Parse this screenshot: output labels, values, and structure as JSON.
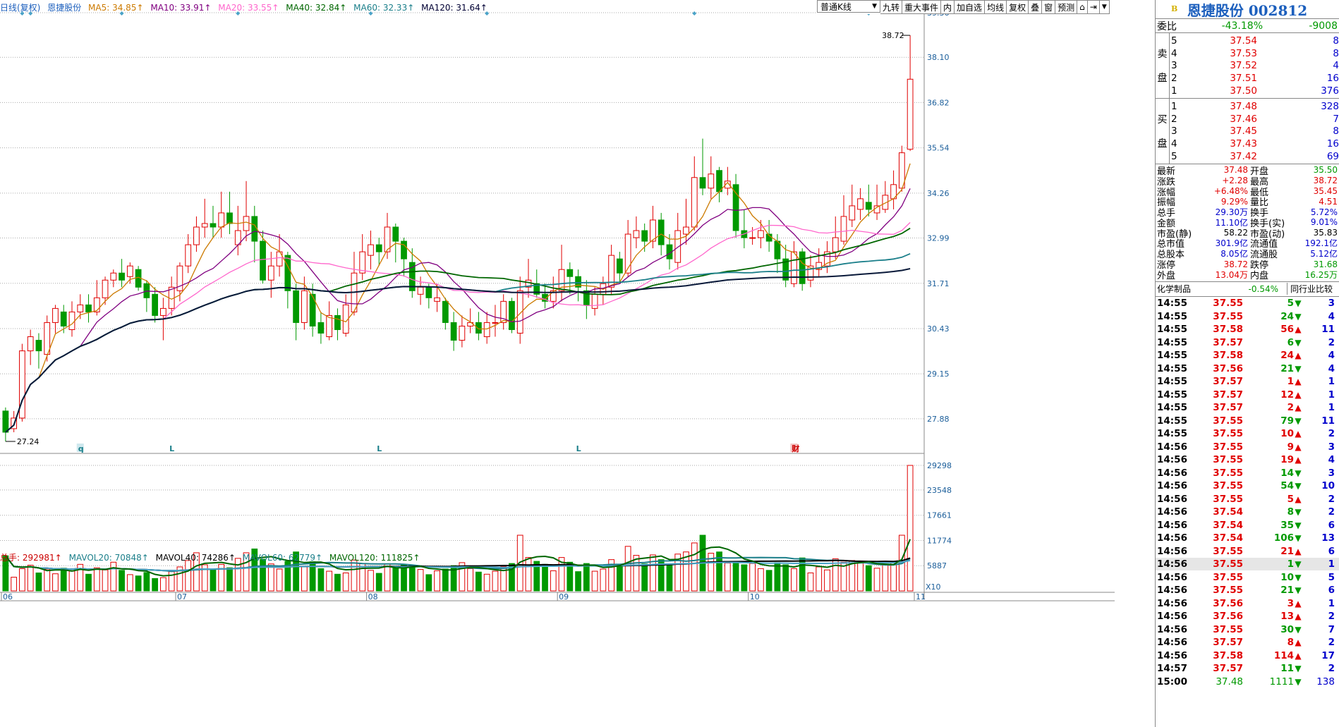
{
  "header": {
    "kline_label": "日线(复权)",
    "stock_name": "恩捷股份",
    "ma": [
      {
        "label": "MA5: 34.85↑",
        "color": "#cc7a00"
      },
      {
        "label": "MA10: 33.91↑",
        "color": "#800080"
      },
      {
        "label": "MA20: 33.55↑",
        "color": "#ff66cc"
      },
      {
        "label": "MA40: 32.84↑",
        "color": "#006600"
      },
      {
        "label": "MA60: 32.33↑",
        "color": "#1b7f8a"
      },
      {
        "label": "MA120: 31.64↑",
        "color": "#000033"
      }
    ]
  },
  "toolbar": {
    "select_value": "普通K线",
    "buttons": [
      "九转",
      "重大事件",
      "内",
      "加自选",
      "均线",
      "复权",
      "叠",
      "窗",
      "预测",
      "⌂",
      "⇥"
    ]
  },
  "price_axis": [
    "39.36",
    "38.10",
    "36.82",
    "35.54",
    "34.26",
    "32.99",
    "31.71",
    "30.43",
    "29.15",
    "27.88"
  ],
  "price_high_label": "38.72",
  "price_low_label": "27.24",
  "markers": [
    {
      "label": "q",
      "color": "#1b7f8a"
    },
    {
      "label": "L",
      "color": "#1b7f8a"
    },
    {
      "label": "L",
      "color": "#1b7f8a"
    },
    {
      "label": "L",
      "color": "#1b7f8a"
    },
    {
      "label": "财",
      "color": "#cc0000"
    }
  ],
  "vol_header": [
    {
      "label": "总手: 292981↑",
      "color": "#cc0000"
    },
    {
      "label": "MAVOL20: 70848↑",
      "color": "#1b7f8a"
    },
    {
      "label": "MAVOL40: 74286↑",
      "color": "#000000"
    },
    {
      "label": "MAVOL60: 62779↑",
      "color": "#1b7f8a"
    },
    {
      "label": "MAVOL120: 111825↑",
      "color": "#006600"
    }
  ],
  "vol_axis": [
    "29298",
    "23548",
    "17661",
    "11774",
    "5887"
  ],
  "vol_unit": "X10",
  "date_axis": [
    "06",
    "07",
    "08",
    "09",
    "10",
    "11"
  ],
  "colors": {
    "up": "#e00000",
    "down": "#009900"
  },
  "panel": {
    "title": "恩捷股份 002812",
    "flag": "B",
    "weibi": {
      "label": "委比",
      "value": "-43.18%",
      "diff": "-9008"
    },
    "sell_label": [
      "卖",
      "盘"
    ],
    "buy_label": [
      "买",
      "盘"
    ],
    "sell": [
      {
        "n": "5",
        "price": "37.54",
        "vol": "8"
      },
      {
        "n": "4",
        "price": "37.53",
        "vol": "8"
      },
      {
        "n": "3",
        "price": "37.52",
        "vol": "4"
      },
      {
        "n": "2",
        "price": "37.51",
        "vol": "16"
      },
      {
        "n": "1",
        "price": "37.50",
        "vol": "376"
      }
    ],
    "buy": [
      {
        "n": "1",
        "price": "37.48",
        "vol": "328"
      },
      {
        "n": "2",
        "price": "37.46",
        "vol": "7"
      },
      {
        "n": "3",
        "price": "37.45",
        "vol": "8"
      },
      {
        "n": "4",
        "price": "37.43",
        "vol": "16"
      },
      {
        "n": "5",
        "price": "37.42",
        "vol": "69"
      }
    ],
    "stats": [
      {
        "l1": "最新",
        "v1": "37.48",
        "c1": "red",
        "l2": "开盘",
        "v2": "35.50",
        "c2": "green"
      },
      {
        "l1": "涨跌",
        "v1": "+2.28",
        "c1": "red",
        "l2": "最高",
        "v2": "38.72",
        "c2": "red"
      },
      {
        "l1": "涨幅",
        "v1": "+6.48%",
        "c1": "red",
        "l2": "最低",
        "v2": "35.45",
        "c2": "red"
      },
      {
        "l1": "振幅",
        "v1": "9.29%",
        "c1": "red",
        "l2": "量比",
        "v2": "4.51",
        "c2": "red"
      },
      {
        "l1": "总手",
        "v1": "29.30万",
        "c1": "blue",
        "l2": "换手",
        "v2": "5.72%",
        "c2": "blue"
      },
      {
        "l1": "金额",
        "v1": "11.10亿",
        "c1": "blue",
        "l2": "换手(实)",
        "v2": "9.01%",
        "c2": "blue"
      },
      {
        "l1": "市盈(静)",
        "v1": "58.22",
        "c1": "",
        "l2": "市盈(动)",
        "v2": "35.83",
        "c2": ""
      },
      {
        "l1": "总市值",
        "v1": "301.9亿",
        "c1": "blue",
        "l2": "流通值",
        "v2": "192.1亿",
        "c2": "blue"
      },
      {
        "l1": "总股本",
        "v1": "8.05亿",
        "c1": "blue",
        "l2": "流通股",
        "v2": "5.12亿",
        "c2": "blue"
      },
      {
        "l1": "涨停",
        "v1": "38.72",
        "c1": "red",
        "l2": "跌停",
        "v2": "31.68",
        "c2": "green"
      },
      {
        "l1": "外盘",
        "v1": "13.04万",
        "c1": "red",
        "l2": "内盘",
        "v2": "16.25万",
        "c2": "green"
      }
    ],
    "industry": {
      "name": "化学制品",
      "change": "-0.54%",
      "button": "同行业比较"
    },
    "ticks": [
      {
        "t": "14:55",
        "p": "37.55",
        "v": "5",
        "d": "down",
        "n": "3"
      },
      {
        "t": "14:55",
        "p": "37.55",
        "v": "24",
        "d": "down",
        "n": "4"
      },
      {
        "t": "14:55",
        "p": "37.58",
        "v": "56",
        "d": "up",
        "n": "11"
      },
      {
        "t": "14:55",
        "p": "37.57",
        "v": "6",
        "d": "down",
        "n": "2"
      },
      {
        "t": "14:55",
        "p": "37.58",
        "v": "24",
        "d": "up",
        "n": "4"
      },
      {
        "t": "14:55",
        "p": "37.56",
        "v": "21",
        "d": "down",
        "n": "4"
      },
      {
        "t": "14:55",
        "p": "37.57",
        "v": "1",
        "d": "up",
        "n": "1"
      },
      {
        "t": "14:55",
        "p": "37.57",
        "v": "12",
        "d": "up",
        "n": "1"
      },
      {
        "t": "14:55",
        "p": "37.57",
        "v": "2",
        "d": "up",
        "n": "1"
      },
      {
        "t": "14:55",
        "p": "37.55",
        "v": "79",
        "d": "down",
        "n": "11"
      },
      {
        "t": "14:55",
        "p": "37.55",
        "v": "10",
        "d": "up",
        "n": "2"
      },
      {
        "t": "14:56",
        "p": "37.55",
        "v": "9",
        "d": "up",
        "n": "3"
      },
      {
        "t": "14:56",
        "p": "37.55",
        "v": "19",
        "d": "up",
        "n": "4"
      },
      {
        "t": "14:56",
        "p": "37.55",
        "v": "14",
        "d": "down",
        "n": "3"
      },
      {
        "t": "14:56",
        "p": "37.55",
        "v": "54",
        "d": "down",
        "n": "10"
      },
      {
        "t": "14:56",
        "p": "37.55",
        "v": "5",
        "d": "up",
        "n": "2"
      },
      {
        "t": "14:56",
        "p": "37.54",
        "v": "8",
        "d": "down",
        "n": "2"
      },
      {
        "t": "14:56",
        "p": "37.54",
        "v": "35",
        "d": "down",
        "n": "6"
      },
      {
        "t": "14:56",
        "p": "37.54",
        "v": "106",
        "d": "down",
        "n": "13"
      },
      {
        "t": "14:56",
        "p": "37.55",
        "v": "21",
        "d": "up",
        "n": "6"
      },
      {
        "t": "14:56",
        "p": "37.55",
        "v": "1",
        "d": "down",
        "n": "1"
      },
      {
        "t": "14:56",
        "p": "37.55",
        "v": "10",
        "d": "down",
        "n": "5"
      },
      {
        "t": "14:56",
        "p": "37.55",
        "v": "21",
        "d": "down",
        "n": "6"
      },
      {
        "t": "14:56",
        "p": "37.56",
        "v": "3",
        "d": "up",
        "n": "1"
      },
      {
        "t": "14:56",
        "p": "37.56",
        "v": "13",
        "d": "up",
        "n": "2"
      },
      {
        "t": "14:56",
        "p": "37.55",
        "v": "30",
        "d": "down",
        "n": "7"
      },
      {
        "t": "14:56",
        "p": "37.57",
        "v": "8",
        "d": "up",
        "n": "2"
      },
      {
        "t": "14:56",
        "p": "37.58",
        "v": "114",
        "d": "up",
        "n": "17"
      },
      {
        "t": "14:57",
        "p": "37.57",
        "v": "11",
        "d": "down",
        "n": "2"
      },
      {
        "t": "15:00",
        "p": "37.48",
        "v": "1111",
        "d": "down",
        "n": "138"
      }
    ]
  },
  "chart_data": {
    "type": "candlestick",
    "y_range_price": [
      27.24,
      39.36
    ],
    "y_range_volume": [
      0,
      29298
    ],
    "candles": [
      [
        28.1,
        27.5,
        28.2,
        27.24,
        8200
      ],
      [
        27.6,
        27.9,
        28.1,
        27.5,
        3200
      ],
      [
        27.9,
        29.8,
        30.0,
        27.8,
        5200
      ],
      [
        29.8,
        30.2,
        30.4,
        29.4,
        6000
      ],
      [
        30.1,
        29.8,
        30.3,
        29.3,
        4200
      ],
      [
        29.7,
        30.6,
        30.8,
        29.5,
        5100
      ],
      [
        30.6,
        31.0,
        31.1,
        30.3,
        4000
      ],
      [
        30.9,
        30.5,
        31.1,
        30.3,
        5300
      ],
      [
        30.4,
        30.9,
        31.2,
        30.2,
        4600
      ],
      [
        30.9,
        31.1,
        31.4,
        30.7,
        6200
      ],
      [
        31.1,
        30.9,
        31.4,
        30.6,
        3900
      ],
      [
        30.9,
        31.3,
        31.8,
        30.8,
        5400
      ],
      [
        31.3,
        31.8,
        31.9,
        31.1,
        4900
      ],
      [
        31.8,
        32.0,
        32.1,
        31.6,
        6700
      ],
      [
        32.0,
        31.8,
        32.4,
        31.6,
        4800
      ],
      [
        31.9,
        32.2,
        32.3,
        31.7,
        3800
      ],
      [
        32.1,
        31.6,
        32.2,
        31.5,
        3500
      ],
      [
        31.7,
        31.3,
        31.8,
        30.9,
        4300
      ],
      [
        31.4,
        30.8,
        31.6,
        30.6,
        2900
      ],
      [
        30.8,
        31.0,
        31.3,
        30.1,
        3100
      ],
      [
        31.0,
        31.6,
        31.9,
        30.8,
        4500
      ],
      [
        31.5,
        32.2,
        32.3,
        31.2,
        5600
      ],
      [
        32.2,
        32.8,
        33.1,
        32.0,
        7100
      ],
      [
        32.8,
        33.3,
        33.6,
        32.6,
        8900
      ],
      [
        33.3,
        33.4,
        34.1,
        33.0,
        6100
      ],
      [
        33.4,
        33.3,
        33.9,
        33.0,
        5000
      ],
      [
        33.3,
        33.7,
        34.3,
        33.0,
        6200
      ],
      [
        33.7,
        33.4,
        34.3,
        33.1,
        5400
      ],
      [
        32.8,
        33.2,
        33.9,
        32.5,
        7600
      ],
      [
        33.2,
        33.6,
        34.6,
        32.9,
        8900
      ],
      [
        33.6,
        32.9,
        33.9,
        32.3,
        9800
      ],
      [
        32.9,
        31.8,
        33.2,
        31.7,
        7400
      ],
      [
        31.8,
        32.2,
        32.6,
        31.3,
        6300
      ],
      [
        32.2,
        32.6,
        33.1,
        31.9,
        5100
      ],
      [
        32.5,
        31.5,
        32.6,
        31.0,
        6900
      ],
      [
        31.5,
        30.6,
        31.7,
        30.1,
        9100
      ],
      [
        30.6,
        31.5,
        31.9,
        30.4,
        5700
      ],
      [
        31.4,
        30.5,
        31.7,
        30.2,
        6800
      ],
      [
        30.6,
        30.3,
        30.9,
        30.0,
        5200
      ],
      [
        30.2,
        30.8,
        31.2,
        30.1,
        4600
      ],
      [
        30.8,
        30.4,
        31.0,
        30.1,
        3900
      ],
      [
        30.3,
        31.1,
        31.4,
        30.2,
        4200
      ],
      [
        30.9,
        32.0,
        32.6,
        30.8,
        7200
      ],
      [
        32.0,
        32.6,
        33.1,
        31.8,
        6400
      ],
      [
        32.5,
        32.8,
        33.2,
        32.1,
        4800
      ],
      [
        32.8,
        32.6,
        33.0,
        32.2,
        4100
      ],
      [
        32.6,
        33.3,
        33.7,
        32.4,
        6300
      ],
      [
        33.3,
        32.9,
        33.4,
        32.3,
        5500
      ],
      [
        32.9,
        32.4,
        33.0,
        31.9,
        6100
      ],
      [
        32.3,
        31.5,
        32.7,
        31.3,
        5900
      ],
      [
        31.4,
        31.6,
        31.9,
        31.1,
        5000
      ],
      [
        31.6,
        31.3,
        31.7,
        31.0,
        3800
      ],
      [
        31.2,
        31.3,
        31.7,
        30.9,
        4700
      ],
      [
        31.2,
        30.6,
        31.3,
        30.4,
        5100
      ],
      [
        30.6,
        30.1,
        30.9,
        29.8,
        5900
      ],
      [
        30.1,
        30.5,
        30.8,
        29.9,
        6600
      ],
      [
        30.5,
        30.6,
        31.0,
        30.3,
        5200
      ],
      [
        30.6,
        30.3,
        30.9,
        30.1,
        4400
      ],
      [
        30.2,
        30.6,
        30.9,
        30.0,
        3900
      ],
      [
        30.6,
        30.6,
        31.1,
        30.2,
        4600
      ],
      [
        30.6,
        31.2,
        31.4,
        30.4,
        5700
      ],
      [
        31.2,
        30.4,
        31.3,
        30.3,
        6400
      ],
      [
        30.3,
        31.5,
        31.9,
        30.0,
        13000
      ],
      [
        31.6,
        31.8,
        32.4,
        31.3,
        7800
      ],
      [
        31.7,
        31.4,
        32.1,
        31.3,
        6900
      ],
      [
        31.4,
        31.2,
        31.7,
        31.0,
        6200
      ],
      [
        31.2,
        31.5,
        31.9,
        31.0,
        4700
      ],
      [
        31.5,
        32.1,
        32.8,
        31.2,
        7800
      ],
      [
        32.1,
        31.9,
        32.3,
        31.4,
        6700
      ],
      [
        31.9,
        31.6,
        32.1,
        31.2,
        4500
      ],
      [
        31.5,
        31.1,
        31.8,
        30.7,
        6400
      ],
      [
        31.0,
        31.4,
        31.6,
        30.8,
        4600
      ],
      [
        31.4,
        31.7,
        31.9,
        31.1,
        5100
      ],
      [
        31.6,
        32.5,
        32.8,
        31.4,
        7300
      ],
      [
        32.4,
        32.0,
        32.6,
        31.7,
        6000
      ],
      [
        32.0,
        33.1,
        33.5,
        31.9,
        10400
      ],
      [
        33.0,
        33.2,
        33.6,
        32.7,
        8300
      ],
      [
        33.2,
        32.9,
        33.4,
        32.6,
        6300
      ],
      [
        32.9,
        33.5,
        33.9,
        32.7,
        8400
      ],
      [
        33.5,
        32.8,
        33.7,
        32.5,
        7300
      ],
      [
        32.8,
        32.4,
        33.1,
        32.1,
        6200
      ],
      [
        32.3,
        33.2,
        33.7,
        32.1,
        8600
      ],
      [
        33.1,
        33.3,
        34.1,
        32.8,
        9100
      ],
      [
        33.3,
        34.7,
        35.3,
        33.2,
        11200
      ],
      [
        34.7,
        34.4,
        35.8,
        34.2,
        13000
      ],
      [
        34.4,
        34.8,
        35.3,
        34.1,
        8800
      ],
      [
        34.9,
        34.3,
        35.0,
        34.0,
        9100
      ],
      [
        34.4,
        34.6,
        35.0,
        34.2,
        6500
      ],
      [
        34.5,
        33.2,
        34.8,
        33.0,
        6800
      ],
      [
        33.2,
        33.0,
        33.8,
        32.7,
        6100
      ],
      [
        33.0,
        33.0,
        33.3,
        32.8,
        6400
      ],
      [
        33.0,
        33.2,
        33.5,
        32.7,
        5200
      ],
      [
        33.1,
        32.9,
        33.5,
        32.6,
        4800
      ],
      [
        32.9,
        32.4,
        33.1,
        32.0,
        6600
      ],
      [
        32.4,
        31.8,
        32.8,
        31.6,
        6100
      ],
      [
        31.7,
        32.6,
        32.9,
        31.6,
        5200
      ],
      [
        32.6,
        31.7,
        32.7,
        31.5,
        7700
      ],
      [
        31.8,
        32.2,
        32.5,
        31.6,
        4200
      ],
      [
        32.1,
        32.3,
        32.7,
        31.9,
        5600
      ],
      [
        32.2,
        32.6,
        32.9,
        32.0,
        4900
      ],
      [
        32.6,
        33.0,
        33.6,
        32.4,
        7500
      ],
      [
        32.9,
        33.6,
        34.2,
        32.8,
        6700
      ],
      [
        33.5,
        33.9,
        34.5,
        33.3,
        7100
      ],
      [
        33.8,
        34.1,
        34.4,
        33.5,
        6800
      ],
      [
        34.0,
        33.8,
        34.5,
        33.6,
        5900
      ],
      [
        33.7,
        33.9,
        34.5,
        33.5,
        5300
      ],
      [
        33.8,
        34.2,
        34.6,
        33.7,
        6100
      ],
      [
        34.1,
        34.5,
        34.9,
        33.8,
        6600
      ],
      [
        34.4,
        35.4,
        35.6,
        34.3,
        13000
      ],
      [
        35.5,
        37.48,
        38.72,
        35.45,
        29298
      ]
    ]
  }
}
